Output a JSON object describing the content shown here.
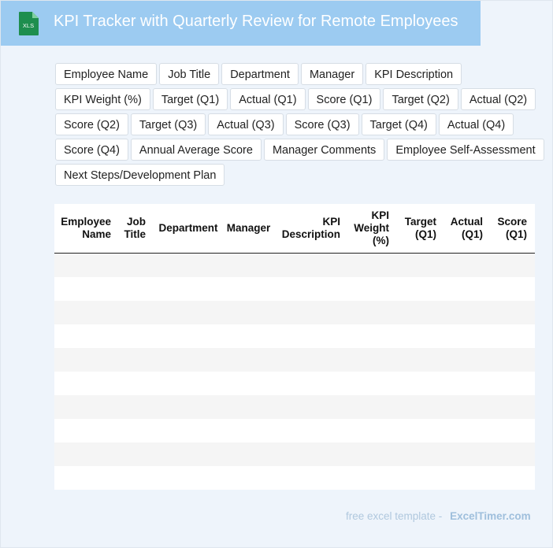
{
  "header": {
    "title": "KPI Tracker with Quarterly Review for Remote Employees",
    "icon_label": "XLS",
    "bg_color": "#9ccbf1",
    "icon_color": "#1e8e4e"
  },
  "columns": [
    "Employee Name",
    "Job Title",
    "Department",
    "Manager",
    "KPI Description",
    "KPI Weight (%)",
    "Target (Q1)",
    "Actual (Q1)",
    "Score (Q1)",
    "Target (Q2)",
    "Actual (Q2)",
    "Score (Q2)",
    "Target (Q3)",
    "Actual (Q3)",
    "Score (Q3)",
    "Target (Q4)",
    "Actual (Q4)",
    "Score (Q4)",
    "Annual Average Score",
    "Manager Comments",
    "Employee Self-Assessment",
    "Next Steps/Development Plan"
  ],
  "table": {
    "headers": [
      "Employee Name",
      "Job Title",
      "Department",
      "Manager",
      "KPI Description",
      "KPI Weight (%)",
      "Target (Q1)",
      "Actual (Q1)",
      "Score (Q1)"
    ],
    "row_count": 10
  },
  "footer": {
    "lead": "free excel template -",
    "brand": "ExcelTimer.com"
  }
}
